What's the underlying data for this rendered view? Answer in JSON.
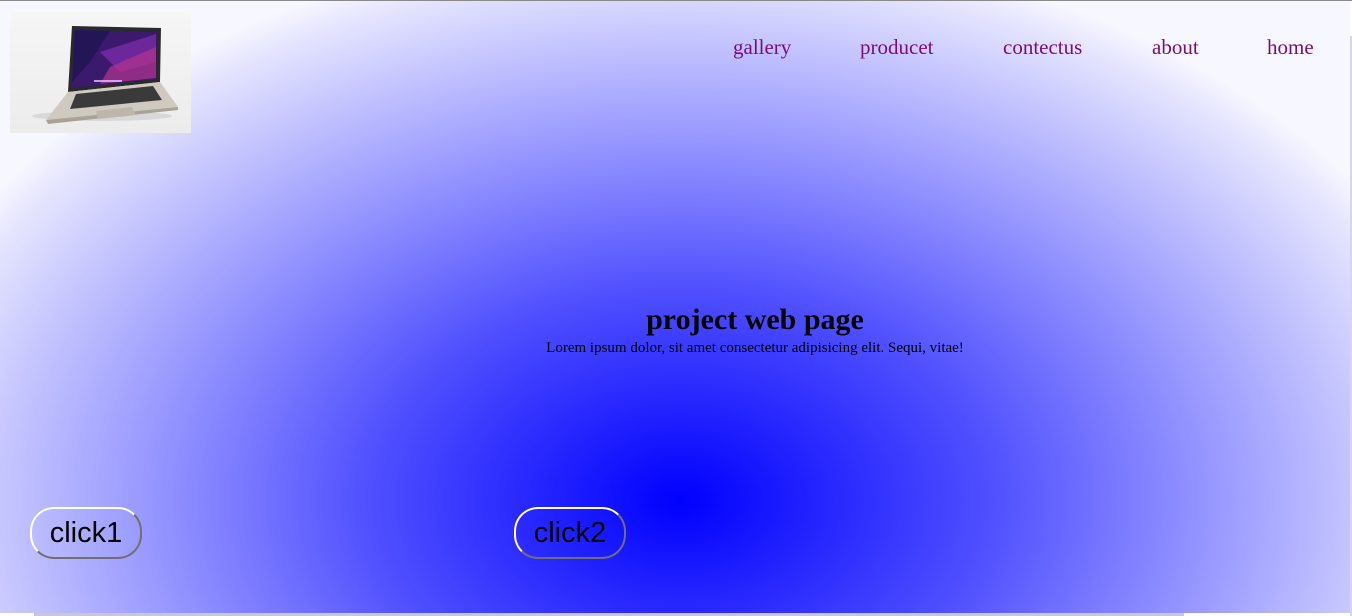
{
  "logo": {
    "icon": "laptop-image"
  },
  "nav": {
    "items": [
      {
        "label": "gallery"
      },
      {
        "label": "producet"
      },
      {
        "label": "contectus"
      },
      {
        "label": "about"
      },
      {
        "label": "home"
      }
    ]
  },
  "hero": {
    "title": "project web page",
    "text": "Lorem ipsum dolor, sit amet consectetur adipisicing elit. Sequi, vitae!"
  },
  "buttons": {
    "click1": "click1",
    "click2": "click2"
  },
  "colors": {
    "nav_link": "#7b0a7b",
    "gradient_center": "#0000ff",
    "gradient_edge": "#f7f7ff"
  }
}
